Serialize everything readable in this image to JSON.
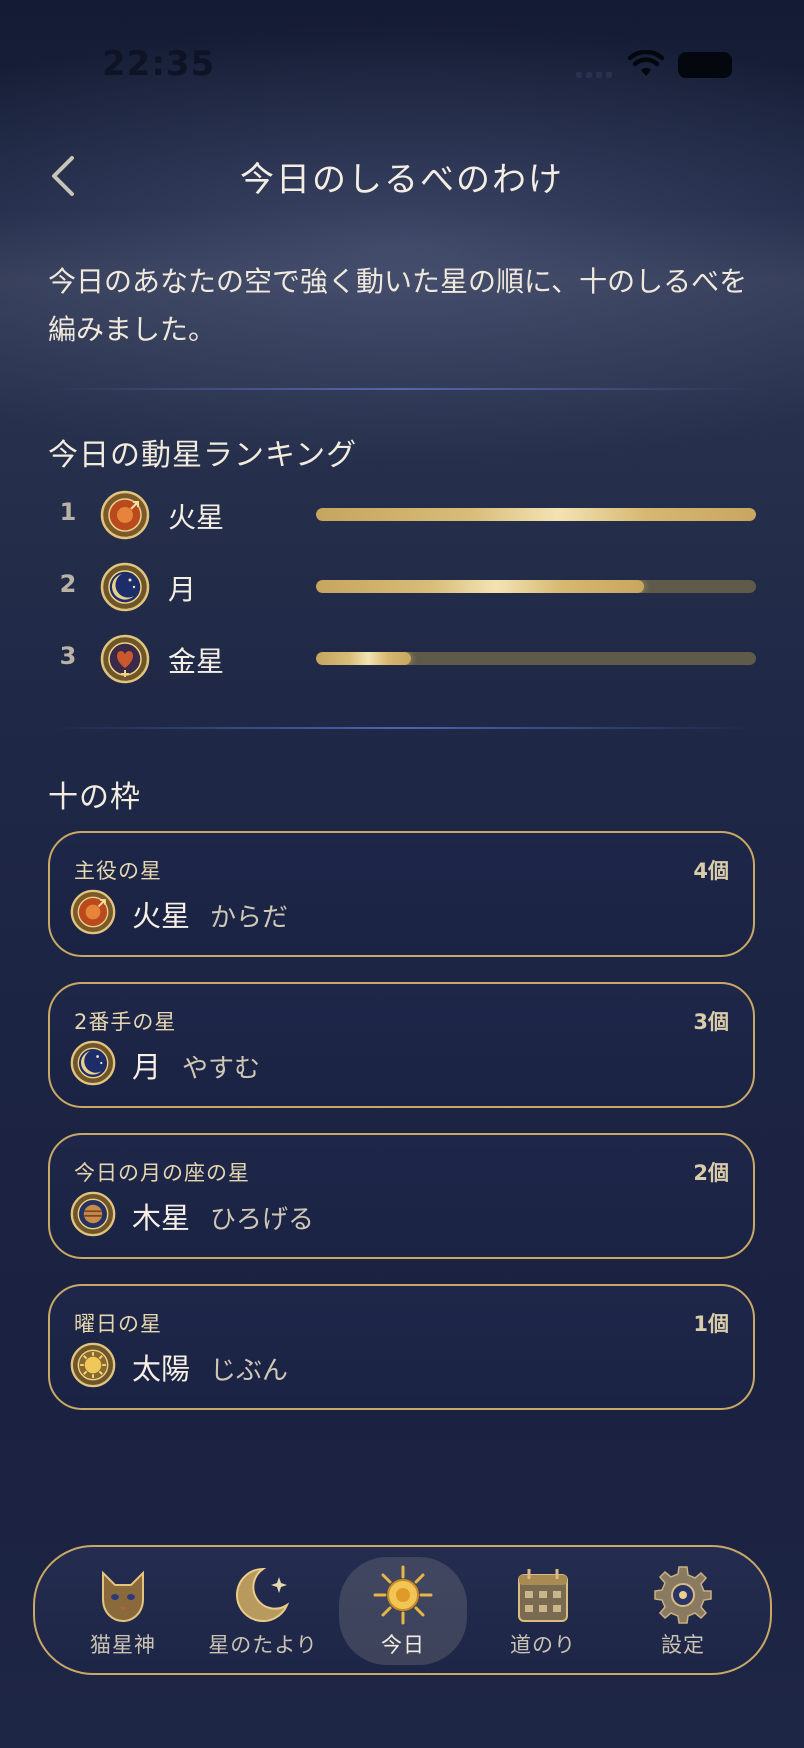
{
  "status_bar": {
    "time": "22:35"
  },
  "header": {
    "title": "今日のしるべのわけ"
  },
  "intro_text": "今日のあなたの空で強く動いた星の順に、十のしるべを編みました。",
  "ranking": {
    "title": "今日の動星ランキング",
    "items": [
      {
        "rank": "1",
        "name": "火星",
        "icon": "mars-medallion-icon",
        "level": 1.0
      },
      {
        "rank": "2",
        "name": "月",
        "icon": "moon-medallion-icon",
        "level": 0.745
      },
      {
        "rank": "3",
        "name": "金星",
        "icon": "venus-medallion-icon",
        "level": 0.215
      }
    ]
  },
  "slots": {
    "title": "十の枠",
    "items": [
      {
        "label": "主役の星",
        "count": "4個",
        "planet": "火星",
        "word": "からだ",
        "icon": "mars-medallion-icon"
      },
      {
        "label": "2番手の星",
        "count": "3個",
        "planet": "月",
        "word": "やすむ",
        "icon": "moon-medallion-icon"
      },
      {
        "label": "今日の月の座の星",
        "count": "2個",
        "planet": "木星",
        "word": "ひろげる",
        "icon": "jupiter-medallion-icon"
      },
      {
        "label": "曜日の星",
        "count": "1個",
        "planet": "太陽",
        "word": "じぶん",
        "icon": "sun-medallion-icon"
      }
    ]
  },
  "tabbar": {
    "items": [
      {
        "label": "猫星神",
        "icon": "cat-icon",
        "active": false
      },
      {
        "label": "星のたより",
        "icon": "crescent-moon-icon",
        "active": false
      },
      {
        "label": "今日",
        "icon": "sun-icon",
        "active": true
      },
      {
        "label": "道のり",
        "icon": "calendar-icon",
        "active": false
      },
      {
        "label": "設定",
        "icon": "gear-icon",
        "active": false
      }
    ]
  },
  "colors": {
    "gold": "#c9a865",
    "background": "#1d2544",
    "text": "#f3ede0"
  }
}
